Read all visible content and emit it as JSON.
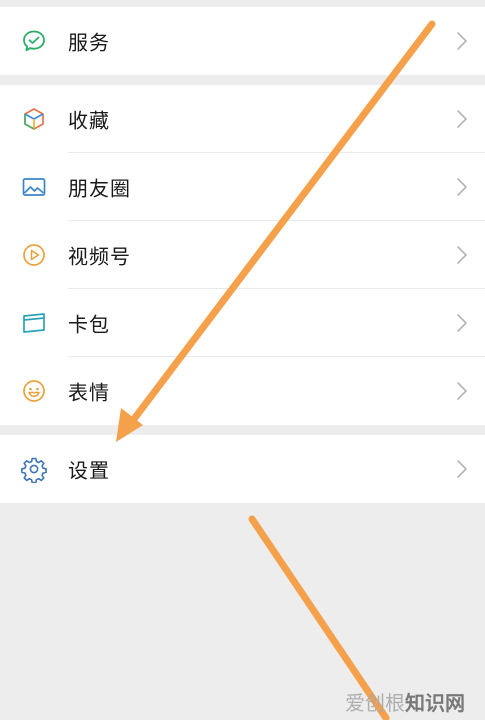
{
  "menu": {
    "service": {
      "label": "服务",
      "icon": "service-icon"
    },
    "favorites": {
      "label": "收藏",
      "icon": "favorites-icon"
    },
    "moments": {
      "label": "朋友圈",
      "icon": "moments-icon"
    },
    "channels": {
      "label": "视频号",
      "icon": "channels-icon"
    },
    "cards": {
      "label": "卡包",
      "icon": "card-wallet-icon"
    },
    "stickers": {
      "label": "表情",
      "icon": "sticker-icon"
    },
    "settings": {
      "label": "设置",
      "icon": "gear-icon"
    }
  },
  "watermark": {
    "part1": "爱创根",
    "part2": "知识网"
  },
  "colors": {
    "background": "#ededed",
    "card": "#ffffff",
    "annotation_arrow": "#f5a04a",
    "service_green": "#2aae67",
    "settings_blue": "#3d74b6"
  }
}
